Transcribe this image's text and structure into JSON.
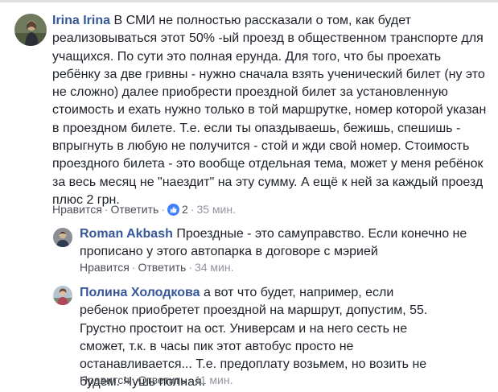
{
  "comments": [
    {
      "author": "Irina Irina",
      "text": "В СМИ не полностью рассказали о том, как будет реализовываться этот 50% -ый проезд в общественном транспорте для учащихся. По сути это полная ерунда. Для того, что бы проехать ребёнку за две гривны - нужно сначала взять ученический билет (ну это не сложно) далее приобрести проездной билет за установленную стоимость и ехать нужно только в той маршрутке, номер которой указан в проездном билете. Т.е. если ты опаздываешь, бежишь, спешишь - впрыгнуть в любую не получится - стой и жди свой номер. Стоимость проездного билета - это вообще отдельная тема, может у меня ребёнок за весь месяц не \"наездит\" на эту сумму. А ещё к ней за каждый проезд плюс 2 грн.",
      "like_label": "Нравится",
      "reply_label": "Ответить",
      "reaction_icon": "like-icon",
      "reaction_count": "2",
      "time": "35 мин."
    },
    {
      "author": "Roman Akbash",
      "text": "Проездные - это самуправство. Если конечно не прописано у этого автопарка в договоре с мэрией",
      "like_label": "Нравится",
      "reply_label": "Ответить",
      "time": "34 мин."
    },
    {
      "author": "Полина Холодкова",
      "text": "а вот что будет, например, если ребенок приобретет проездной на маршрут, допустим, 55. Грустно простоит на ост. Универсам и на него сесть не сможет, т.к. в часы пик этот автобус просто не останавливается... Т.е. предоплату возьмем, но возить не будем. Чушь полная.",
      "like_label": "Нравится",
      "reply_label": "Ответить",
      "time": "11 мин."
    }
  ],
  "separator": "·",
  "colors": {
    "author": "#365899",
    "text": "#1d2129",
    "meta": "#90949c",
    "link": "#4b4f56",
    "like_badge": "#4080ff"
  }
}
